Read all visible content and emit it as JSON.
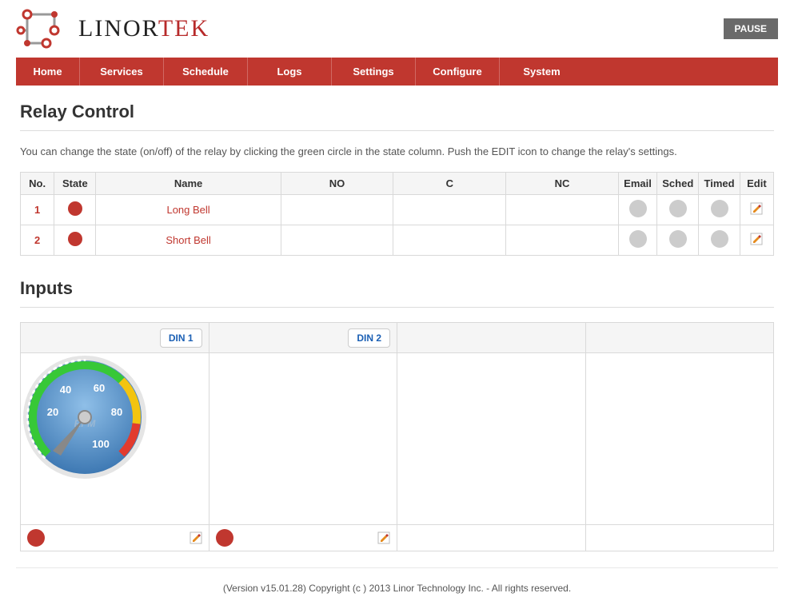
{
  "header": {
    "logo_text1": "LINOR",
    "logo_text2": "TEK",
    "pause_label": "PAUSE"
  },
  "nav": [
    "Home",
    "Services",
    "Schedule",
    "Logs",
    "Settings",
    "Configure",
    "System"
  ],
  "relay_section": {
    "title": "Relay Control",
    "intro": "You can change the state (on/off) of the relay by clicking the green circle in the state column. Push the EDIT icon to change the relay's settings.",
    "columns": {
      "no": "No.",
      "state": "State",
      "name": "Name",
      "NO": "NO",
      "C": "C",
      "NC": "NC",
      "email": "Email",
      "sched": "Sched",
      "timed": "Timed",
      "edit": "Edit"
    },
    "rows": [
      {
        "no": "1",
        "name": "Long Bell",
        "NO": "",
        "C": "",
        "NC": ""
      },
      {
        "no": "2",
        "name": "Short Bell",
        "NO": "",
        "C": "",
        "NC": ""
      }
    ]
  },
  "inputs_section": {
    "title": "Inputs",
    "din_labels": [
      "DIN 1",
      "DIN 2"
    ],
    "gauge": {
      "ticks": [
        "20",
        "40",
        "60",
        "80",
        "100"
      ],
      "unit": "RPM",
      "value": 0
    }
  },
  "footer": "(Version v15.01.28) Copyright (c ) 2013 Linor Technology Inc. - All rights reserved."
}
